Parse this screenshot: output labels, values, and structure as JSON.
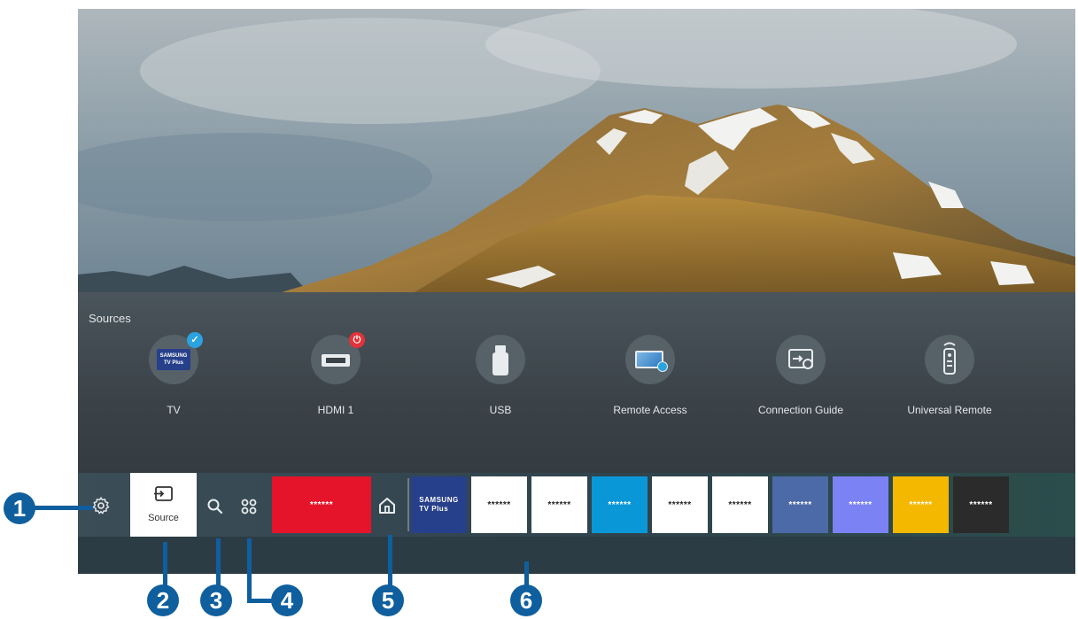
{
  "sources_panel": {
    "title": "Sources",
    "items": [
      {
        "label": "TV",
        "icon": "samsung-tv-plus-icon",
        "logo_line1": "SAMSUNG",
        "logo_line2": "TV Plus",
        "badge": "✓",
        "badge_color": "#2aa3e0"
      },
      {
        "label": "HDMI 1",
        "icon": "hdmi-icon",
        "badge": "⏻",
        "badge_color": "#e2323a"
      },
      {
        "label": "USB",
        "icon": "usb-icon"
      },
      {
        "label": "Remote Access",
        "icon": "remote-access-icon"
      },
      {
        "label": "Connection Guide",
        "icon": "connection-guide-icon"
      },
      {
        "label": "Universal Remote",
        "icon": "universal-remote-icon"
      }
    ]
  },
  "home_bar": {
    "settings_icon": "gear-icon",
    "source_label": "Source",
    "search_icon": "search-icon",
    "apps_icon": "apps-icon",
    "home_icon": "home-icon",
    "featured_tile": {
      "text": "******",
      "color": "#e5142a",
      "text_color": "#ffffff"
    },
    "app_tiles": [
      {
        "line1": "SAMSUNG",
        "line2": "TV Plus",
        "color": "#27408b",
        "text_color": "#ffffff"
      },
      {
        "text": "******",
        "color": "#ffffff",
        "text_color": "#222222"
      },
      {
        "text": "******",
        "color": "#ffffff",
        "text_color": "#222222"
      },
      {
        "text": "******",
        "color": "#0a97d8",
        "text_color": "#ffffff"
      },
      {
        "text": "******",
        "color": "#ffffff",
        "text_color": "#222222"
      },
      {
        "text": "******",
        "color": "#ffffff",
        "text_color": "#222222"
      },
      {
        "text": "******",
        "color": "#4d6aa8",
        "text_color": "#ffffff"
      },
      {
        "text": "******",
        "color": "#7b82f3",
        "text_color": "#ffffff"
      },
      {
        "text": "******",
        "color": "#f5b800",
        "text_color": "#ffffff"
      },
      {
        "text": "******",
        "color": "#2b2b2b",
        "text_color": "#ffffff"
      }
    ]
  },
  "callouts": [
    "1",
    "2",
    "3",
    "4",
    "5",
    "6"
  ],
  "colors": {
    "callout": "#0f5f9e"
  }
}
